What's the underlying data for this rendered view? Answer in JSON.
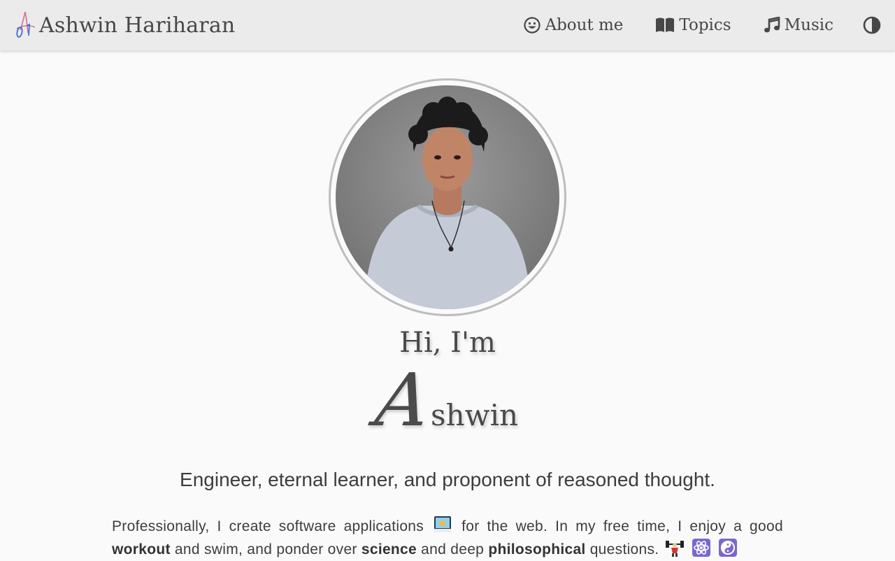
{
  "site": {
    "brand_name": "Ashwin Hariharan"
  },
  "nav": {
    "items": [
      {
        "label": "About me",
        "icon": "smile-icon"
      },
      {
        "label": "Topics",
        "icon": "book-open-icon"
      },
      {
        "label": "Music",
        "icon": "music-note-icon"
      }
    ],
    "theme_toggle_icon": "contrast-icon"
  },
  "hero": {
    "greeting": "Hi, I'm",
    "name_initial": "A",
    "name_rest": "shwin",
    "tagline": "Engineer, eternal learner, and proponent of reasoned thought."
  },
  "bio": {
    "part1": "Professionally, I create software applications",
    "part2": "for the web. In my free time, I enjoy a good",
    "workout": "workout",
    "part3": "and swim, and ponder over",
    "science": "science",
    "part4": "and deep",
    "philosophical": "philosophical",
    "part5": "questions.",
    "emojis": [
      "laptop-emoji",
      "weightlifter-emoji",
      "atom-emoji",
      "yin-yang-emoji"
    ]
  },
  "colors": {
    "navbar_bg": "#ebebeb",
    "page_bg": "#fafafa",
    "text": "#474747",
    "emoji_purple": "#7b68c9"
  }
}
